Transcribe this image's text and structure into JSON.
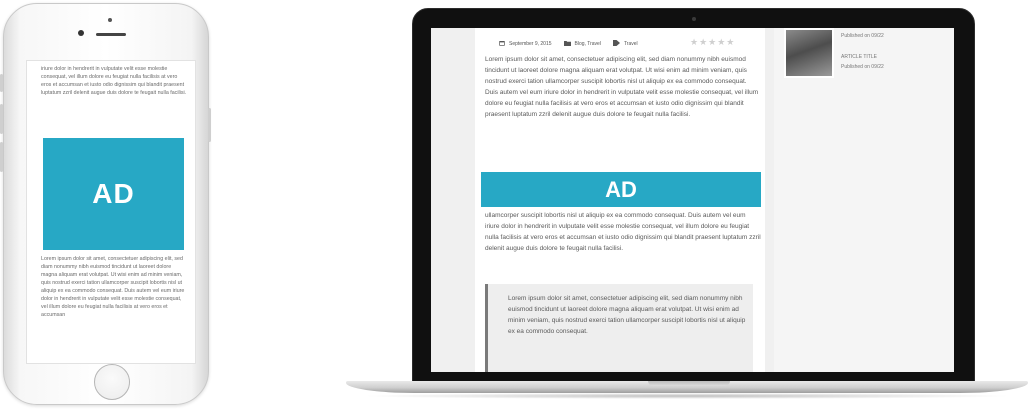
{
  "phone": {
    "ad_label": "AD",
    "paragraph_top": "iriure dolor in hendrerit in vulputate velit esse molestie consequat, vel illum dolore eu feugiat nulla facilisis at vero eros et accumsan et iusto odio dignissim qui blandit praesent luptatum zzril delenit augue duis dolore te feugait nulla facilisi.",
    "paragraph_bottom": "Lorem ipsum dolor sit amet, consectetuer adipiscing elit, sed diam nonummy nibh euismod tincidunt ut laoreet dolore magna aliquam erat volutpat. Ut wisi enim ad minim veniam, quis nostrud exerci tation ullamcorper suscipit lobortis nisl ut aliquip ex ea commodo consequat. Duis autem vel eum iriure dolor in hendrerit in vulputate velit esse molestie consequat, vel illum dolore eu feugiat nulla facilisis at vero eros et accumsan"
  },
  "laptop": {
    "meta": {
      "date": "September 9, 2015",
      "categories": "Blog, Travel",
      "tags": "Travel",
      "date_icon": "calendar-icon",
      "category_icon": "folder-icon",
      "tag_icon": "tag-icon"
    },
    "rating": "★★★★★",
    "ad_label": "AD",
    "paragraph_1": "Lorem ipsum dolor sit amet, consectetuer adipiscing elit, sed diam nonummy nibh euismod tincidunt ut laoreet dolore magna aliquam erat volutpat. Ut wisi enim ad minim veniam, quis nostrud exerci tation ullamcorper suscipit lobortis nisl ut aliquip ex ea commodo consequat. Duis autem vel eum iriure dolor in hendrerit in vulputate velit esse molestie consequat, vel illum dolore eu feugiat nulla facilisis at vero eros et accumsan et iusto odio dignissim qui blandit praesent luptatum zzril delenit augue duis dolore te feugait nulla facilisi.",
    "paragraph_2": "ullamcorper suscipit lobortis nisl ut aliquip ex ea commodo consequat. Duis autem vel eum iriure dolor in hendrerit in vulputate velit esse molestie consequat, vel illum dolore eu feugiat nulla facilisis at vero eros et accumsan et iusto odio dignissim qui blandit praesent luptatum zzril delenit augue duis dolore te feugait nulla facilisi.",
    "blockquote": "Lorem ipsum dolor sit amet, consectetuer adipiscing elit, sed diam nonummy nibh euismod tincidunt ut laoreet dolore magna aliquam erat volutpat. Ut wisi enim ad minim veniam, quis nostrud exerci tation ullamcorper suscipit lobortis nisl ut aliquip ex ea commodo consequat.",
    "sidebar": {
      "published_1": "Published on 09/22",
      "article_title": "ARTICLE TITLE",
      "published_2": "Published on 09/22"
    }
  },
  "colors": {
    "ad_accent": "#27a8c5"
  }
}
